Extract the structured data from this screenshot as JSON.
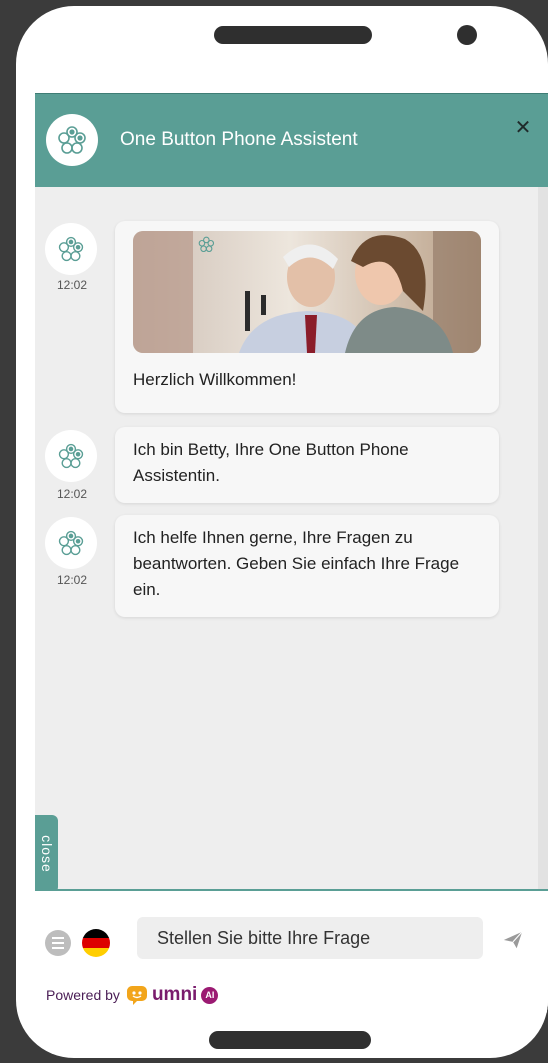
{
  "header": {
    "title": "One Button Phone Assistent",
    "close_icon": "close-icon"
  },
  "messages": [
    {
      "time": "12:02",
      "text": "Herzlich Willkommen!",
      "has_image": true
    },
    {
      "time": "12:02",
      "text": "Ich bin Betty, Ihre One Button Phone Assistentin."
    },
    {
      "time": "12:02",
      "text": "Ich helfe Ihnen gerne, Ihre Fragen zu beantworten. Geben Sie einfach Ihre Frage ein."
    }
  ],
  "side_tab": {
    "label": "close"
  },
  "footer": {
    "input_placeholder": "Stellen Sie bitte Ihre Frage",
    "powered_label": "Powered by",
    "brand_name": "umni",
    "brand_badge": "AI"
  },
  "colors": {
    "accent": "#5a9e95",
    "chat_background": "#eeeeee",
    "brand": "#7a1c6d"
  }
}
